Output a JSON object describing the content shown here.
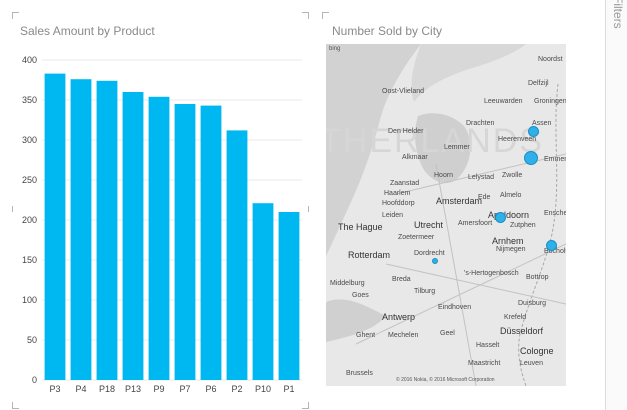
{
  "bar_chart": {
    "title": "Sales Amount by Product"
  },
  "map_chart": {
    "title": "Number Sold by City",
    "bing_logo": "bing",
    "copyright": "© 2016 Nokia, © 2016 Microsoft Corporation",
    "watermark": "THERLANDS",
    "places": [
      {
        "name": "Noordst",
        "big": false
      },
      {
        "name": "Oost-Vlieland",
        "big": false
      },
      {
        "name": "Delfzijl",
        "big": false
      },
      {
        "name": "Leeuwarden",
        "big": false
      },
      {
        "name": "Groningen",
        "big": false
      },
      {
        "name": "Drachten",
        "big": false
      },
      {
        "name": "Assen",
        "big": false
      },
      {
        "name": "Den Helder",
        "big": false
      },
      {
        "name": "Heerenveen",
        "big": false
      },
      {
        "name": "Lemmer",
        "big": false
      },
      {
        "name": "Alkmaar",
        "big": false
      },
      {
        "name": "Emmen",
        "big": false
      },
      {
        "name": "Hoorn",
        "big": false
      },
      {
        "name": "Lelystad",
        "big": false
      },
      {
        "name": "Zwolle",
        "big": false
      },
      {
        "name": "Zaanstad",
        "big": false
      },
      {
        "name": "Haarlem",
        "big": false
      },
      {
        "name": "Amsterdam",
        "big": true
      },
      {
        "name": "Hoofddorp",
        "big": false
      },
      {
        "name": "Ede",
        "big": false
      },
      {
        "name": "Almelo",
        "big": false
      },
      {
        "name": "Leiden",
        "big": false
      },
      {
        "name": "Apeldoorn",
        "big": true
      },
      {
        "name": "Enschede",
        "big": false
      },
      {
        "name": "The Hague",
        "big": true
      },
      {
        "name": "Utrecht",
        "big": true
      },
      {
        "name": "Amersfoort",
        "big": false
      },
      {
        "name": "Zutphen",
        "big": false
      },
      {
        "name": "Zoetermeer",
        "big": false
      },
      {
        "name": "Arnhem",
        "big": true
      },
      {
        "name": "Rotterdam",
        "big": true
      },
      {
        "name": "Dordrecht",
        "big": false
      },
      {
        "name": "Nijmegen",
        "big": false
      },
      {
        "name": "Bocholt",
        "big": false
      },
      {
        "name": "'s-Hertogenbosch",
        "big": false
      },
      {
        "name": "Breda",
        "big": false
      },
      {
        "name": "Middelburg",
        "big": false
      },
      {
        "name": "Tilburg",
        "big": false
      },
      {
        "name": "Bottrop",
        "big": false
      },
      {
        "name": "Goes",
        "big": false
      },
      {
        "name": "Duisburg",
        "big": false
      },
      {
        "name": "Eindhoven",
        "big": false
      },
      {
        "name": "Antwerp",
        "big": true
      },
      {
        "name": "Krefeld",
        "big": false
      },
      {
        "name": "Düsseldorf",
        "big": true
      },
      {
        "name": "Ghent",
        "big": false
      },
      {
        "name": "Mechelen",
        "big": false
      },
      {
        "name": "Geel",
        "big": false
      },
      {
        "name": "Hasselt",
        "big": false
      },
      {
        "name": "Maastricht",
        "big": false
      },
      {
        "name": "Cologne",
        "big": true
      },
      {
        "name": "Brussels",
        "big": false
      },
      {
        "name": "Leuven",
        "big": false
      }
    ],
    "city_dots": [
      {
        "id": "groningen",
        "size": "small"
      },
      {
        "id": "assen",
        "size": "large"
      },
      {
        "id": "zwolle",
        "size": "small"
      },
      {
        "id": "enschede",
        "size": "small"
      },
      {
        "id": "utrecht",
        "size": "tiny"
      }
    ],
    "bubble_color": "#2fb0e8"
  },
  "filters_pane": {
    "label": "Filters"
  },
  "colors": {
    "bar": "#00b8f1",
    "grid": "#e8e8e8"
  },
  "chart_data": {
    "type": "bar",
    "title": "Sales Amount by Product",
    "categories": [
      "P3",
      "P4",
      "P18",
      "P13",
      "P9",
      "P7",
      "P6",
      "P2",
      "P10",
      "P1"
    ],
    "values": [
      383,
      376,
      374,
      360,
      354,
      345,
      343,
      312,
      221,
      210
    ],
    "ylim": [
      0,
      400
    ],
    "yticks": [
      0,
      50,
      100,
      150,
      200,
      250,
      300,
      350,
      400
    ],
    "xlabel": "",
    "ylabel": "",
    "grid": true
  }
}
